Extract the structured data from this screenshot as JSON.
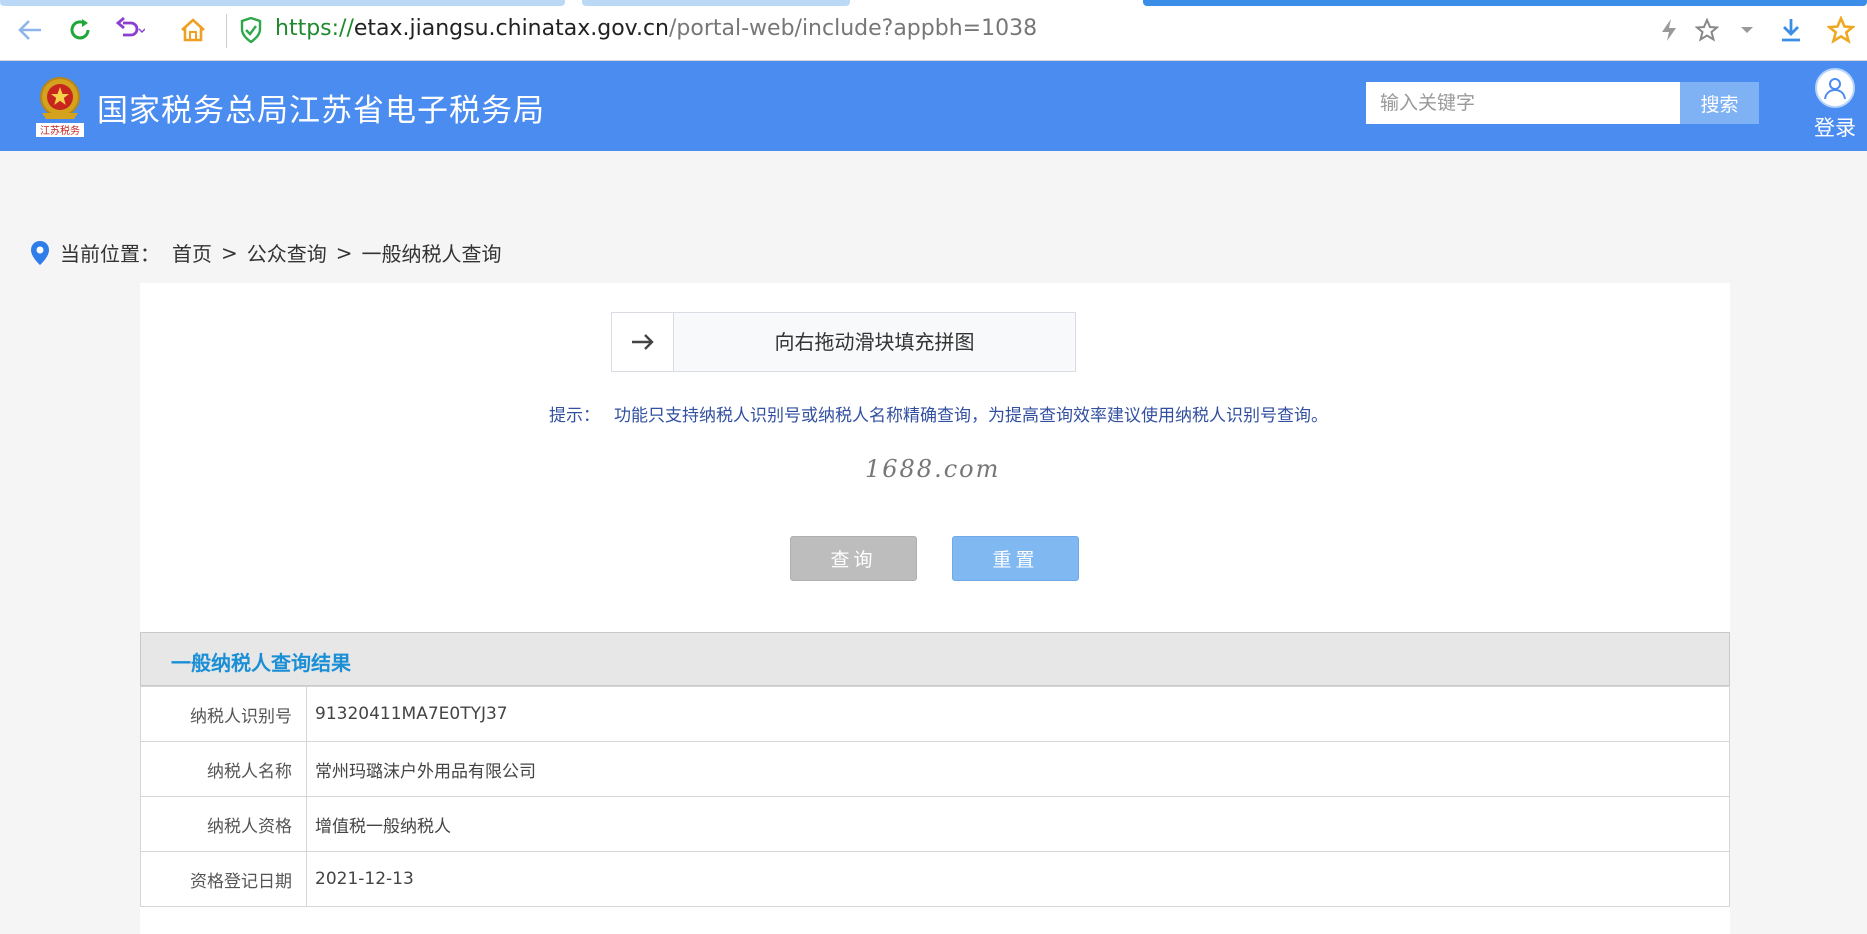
{
  "browser": {
    "url_scheme": "https://",
    "url_host": "etax.jiangsu.chinatax.gov.cn",
    "url_path": "/portal-web/include?appbh=1038"
  },
  "header": {
    "title": "国家税务总局江苏省电子税务局",
    "emblem_text": "江苏税务",
    "search_placeholder": "输入关键字",
    "search_button": "搜索",
    "login_label": "登录"
  },
  "breadcrumb": {
    "label": "当前位置：",
    "items": [
      "首页",
      "公众查询",
      "一般纳税人查询"
    ],
    "separator": ">"
  },
  "slider": {
    "text": "向右拖动滑块填充拼图"
  },
  "hint": {
    "label": "提示：",
    "text": "功能只支持纳税人识别号或纳税人名称精确查询，为提高查询效率建议使用纳税人识别号查询。"
  },
  "watermark": "1688.com",
  "buttons": {
    "query": "查询",
    "reset": "重置"
  },
  "results": {
    "title": "一般纳税人查询结果",
    "rows": [
      {
        "key": "纳税人识别号",
        "value": "91320411MA7E0TYJ37"
      },
      {
        "key": "纳税人名称",
        "value": "常州玛璐沫户外用品有限公司"
      },
      {
        "key": "纳税人资格",
        "value": "增值税一般纳税人"
      },
      {
        "key": "资格登记日期",
        "value": "2021-12-13"
      }
    ]
  },
  "colors": {
    "header_bg": "#4a8cf0",
    "accent_title": "#1a8fd6",
    "hint_text": "#3350a0"
  }
}
